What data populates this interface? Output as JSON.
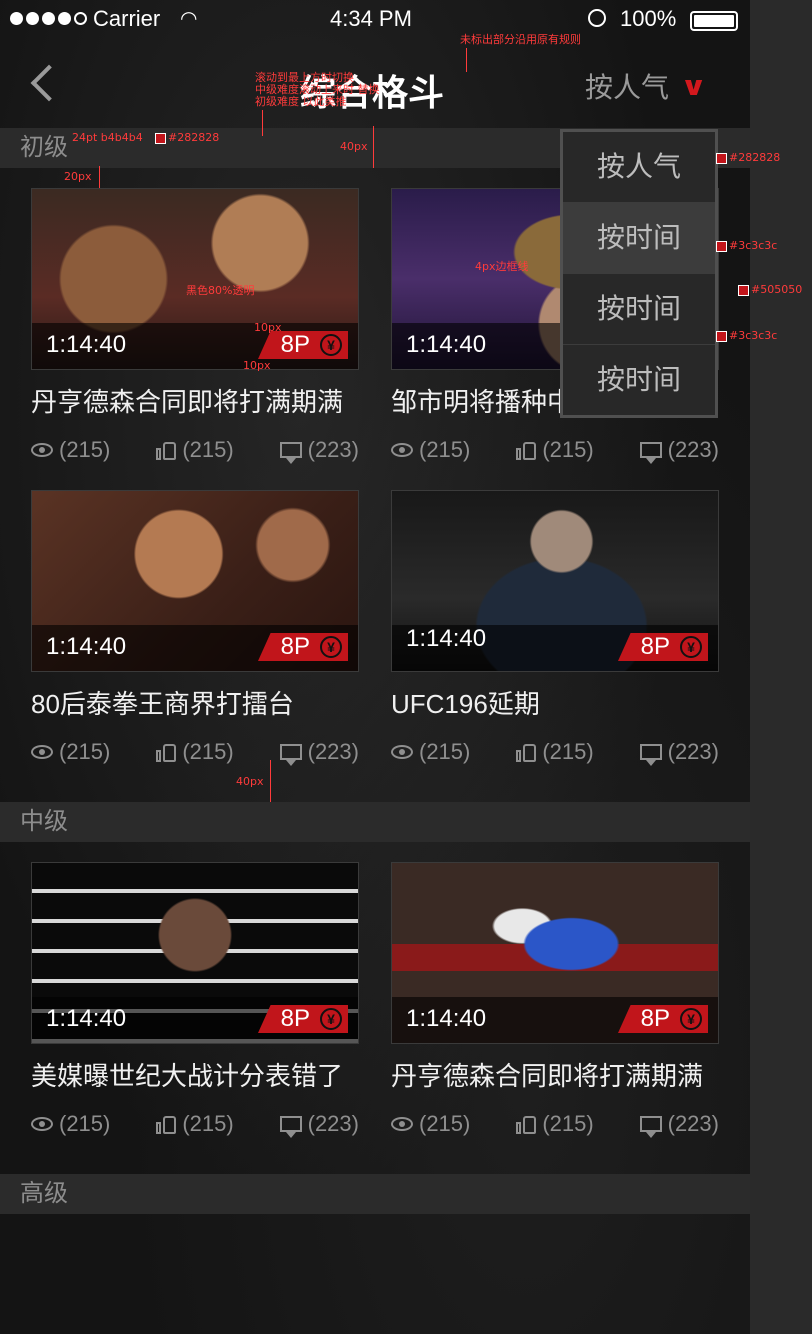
{
  "status_bar": {
    "carrier": "Carrier",
    "time": "4:34 PM",
    "battery": "100%"
  },
  "nav": {
    "title": "综合格斗",
    "sort_label": "按人气",
    "sort_icon": "chevron-down-icon",
    "accent": "#d3181d"
  },
  "dropdown": {
    "options": [
      "按人气",
      "按时间",
      "按时间",
      "按时间"
    ]
  },
  "sections": [
    {
      "label": "初级",
      "cards": [
        {
          "duration": "1:14:40",
          "pages": "8P",
          "title": "丹亨德森合同即将打满期满",
          "views": "(215)",
          "likes": "(215)",
          "comments": "(223)"
        },
        {
          "duration": "1:14:40",
          "pages": "",
          "title": "邹市明将播种中国拳坛",
          "views": "(215)",
          "likes": "(215)",
          "comments": "(223)"
        },
        {
          "duration": "1:14:40",
          "pages": "8P",
          "title": "80后泰拳王商界打擂台",
          "views": "(215)",
          "likes": "(215)",
          "comments": "(223)"
        },
        {
          "duration": "1:14:40",
          "pages": "8P",
          "title": "UFC196延期",
          "views": "(215)",
          "likes": "(215)",
          "comments": "(223)"
        }
      ]
    },
    {
      "label": "中级",
      "cards": [
        {
          "duration": "1:14:40",
          "pages": "8P",
          "title": "美媒曝世纪大战计分表错了",
          "views": "(215)",
          "likes": "(215)",
          "comments": "(223)"
        },
        {
          "duration": "1:14:40",
          "pages": "8P",
          "title": "丹亨德森合同即将打满期满",
          "views": "(215)",
          "likes": "(215)",
          "comments": "(223)"
        }
      ]
    },
    {
      "label": "高级",
      "cards": []
    }
  ],
  "annotations": {
    "top_note": "未标出部分沿用原有规则",
    "scroll_note_1": "滚动到最上方时切换",
    "scroll_note_2": "中级难度滚动上来时 替换",
    "scroll_note_3": "初级难度 以此类推",
    "section_font": "24pt b4b4b4",
    "section_color": "#282828",
    "gap_20": "20px",
    "gap_40": "40px",
    "gap_40b": "40px",
    "overlay": "黑色80%透明",
    "pad_10a": "10px",
    "pad_10b": "10px",
    "border_4": "4px边框线",
    "dd_c1": "#282828",
    "dd_c2": "#3c3c3c",
    "dd_c3": "#505050",
    "dd_c4": "#3c3c3c"
  }
}
